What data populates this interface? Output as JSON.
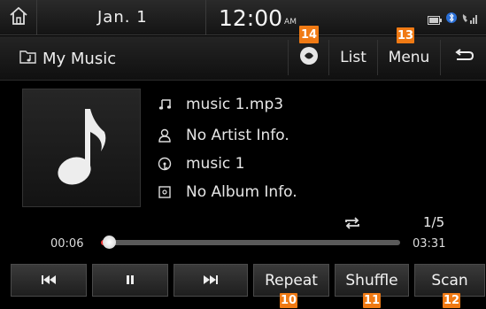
{
  "status": {
    "date": "Jan.  1",
    "time": "12:00",
    "ampm": "AM"
  },
  "header": {
    "source_title": "My Music",
    "list_label": "List",
    "menu_label": "Menu"
  },
  "track": {
    "filename": "music 1.mp3",
    "artist": "No Artist Info.",
    "title": "music 1",
    "album": "No Album Info.",
    "index": "1/5",
    "elapsed": "00:06",
    "total": "03:31",
    "progress_fraction": 0.028
  },
  "controls": {
    "repeat_label": "Repeat",
    "shuffle_label": "Shuffle",
    "scan_label": "Scan"
  },
  "callouts": {
    "repeat": "10",
    "shuffle": "11",
    "scan": "12",
    "menu": "13",
    "sound": "14"
  },
  "colors": {
    "callout": "#f07a14",
    "progress": "#e33333"
  }
}
